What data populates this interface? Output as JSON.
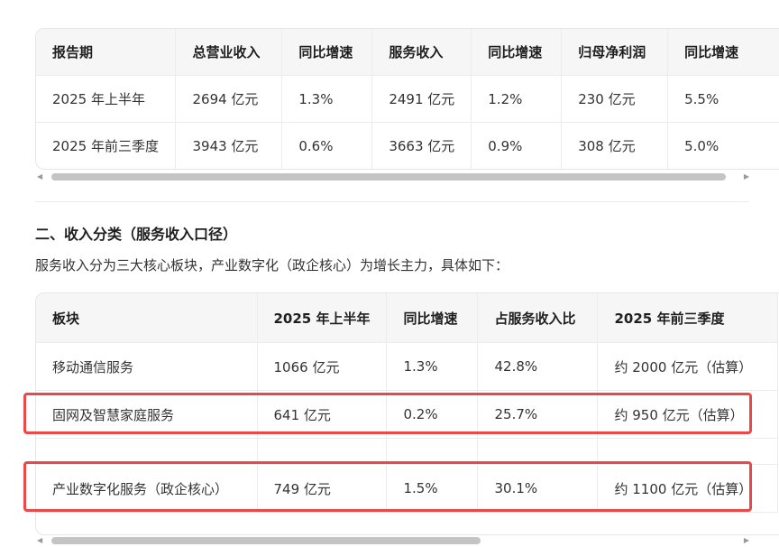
{
  "table1": {
    "headers": [
      "报告期",
      "总营业收入",
      "同比增速",
      "服务收入",
      "同比增速",
      "归母净利润",
      "同比增速"
    ],
    "rows": [
      [
        "2025 年上半年",
        "2694 亿元",
        "1.3%",
        "2491 亿元",
        "1.2%",
        "230 亿元",
        "5.5%"
      ],
      [
        "2025 年前三季度",
        "3943 亿元",
        "0.6%",
        "3663 亿元",
        "0.9%",
        "308 亿元",
        "5.0%"
      ]
    ]
  },
  "section": {
    "heading": "二、收入分类（服务收入口径）",
    "intro": "服务收入分为三大核心板块，产业数字化（政企核心）为增长主力，具体如下："
  },
  "table2": {
    "headers": [
      "板块",
      "2025 年上半年",
      "同比增速",
      "占服务收入比",
      "2025 年前三季度"
    ],
    "rows": [
      [
        "移动通信服务",
        "1066 亿元",
        "1.3%",
        "42.8%",
        "约 2000 亿元（估算）"
      ],
      [
        "固网及智慧家庭服务",
        "641 亿元",
        "0.2%",
        "25.7%",
        "约 950 亿元（估算）"
      ],
      [
        "",
        "",
        "",
        "",
        ""
      ],
      [
        "产业数字化服务（政企核心）",
        "749 亿元",
        "1.5%",
        "30.1%",
        "约 1100 亿元（估算）"
      ]
    ]
  },
  "scrollbars": {
    "arrow_left": "◀",
    "arrow_right": "▶"
  },
  "highlight_color": "#e84a4a"
}
